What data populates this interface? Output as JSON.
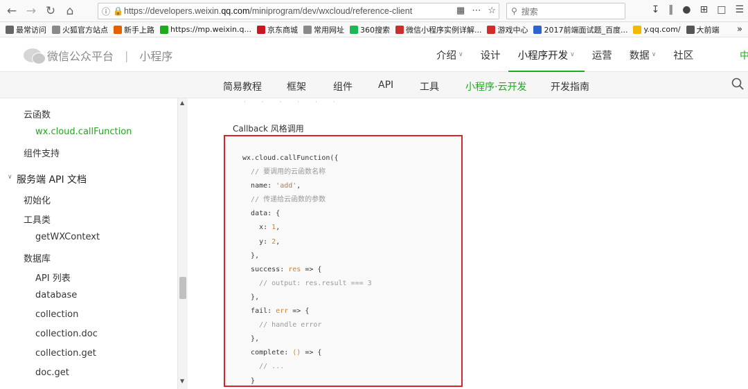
{
  "browser": {
    "url_prefix": "https://developers.weixin.",
    "url_domain": "qq.com",
    "url_path": "/miniprogram/dev/wxcloud/reference-client",
    "search_placeholder": "搜索",
    "bookmarks": [
      {
        "label": "最常访问",
        "icon": "gear-icon",
        "color": "#666666"
      },
      {
        "label": "火狐官方站点",
        "icon": "folder-icon",
        "color": "#8a8a8a"
      },
      {
        "label": "新手上路",
        "icon": "firefox-icon",
        "color": "#e66000"
      },
      {
        "label": "https://mp.weixin.q...",
        "icon": "wechat-icon",
        "color": "#1aad19"
      },
      {
        "label": "京东商城",
        "icon": "jd-icon",
        "color": "#c91623"
      },
      {
        "label": "常用网址",
        "icon": "folder-icon",
        "color": "#8a8a8a"
      },
      {
        "label": "360搜索",
        "icon": "360-icon",
        "color": "#19b955"
      },
      {
        "label": "微信小程序实例详解...",
        "icon": "csdn-icon",
        "color": "#c9302c"
      },
      {
        "label": "游戏中心",
        "icon": "game-icon",
        "color": "#d12b2b"
      },
      {
        "label": "2017前端面试题_百度...",
        "icon": "baidu-icon",
        "color": "#2d64cf"
      },
      {
        "label": "y.qq.com/",
        "icon": "qqmusic-icon",
        "color": "#f5b800"
      },
      {
        "label": "大前端",
        "icon": "globe-icon",
        "color": "#555555"
      }
    ]
  },
  "site": {
    "logo_text": "微信公众平台",
    "divider": "|",
    "section": "小程序",
    "nav": [
      {
        "label": "介绍",
        "dropdown": true
      },
      {
        "label": "设计",
        "dropdown": false
      },
      {
        "label": "小程序开发",
        "dropdown": true,
        "active": true
      },
      {
        "label": "运营",
        "dropdown": false
      },
      {
        "label": "数据",
        "dropdown": true
      },
      {
        "label": "社区",
        "dropdown": false
      }
    ],
    "nav_cut": "中",
    "subnav": [
      "简易教程",
      "框架",
      "组件",
      "API",
      "工具",
      "小程序·云开发",
      "开发指南"
    ],
    "subnav_active": "小程序·云开发"
  },
  "sidebar": {
    "items": [
      {
        "label": "云函数"
      },
      {
        "label": "wx.cloud.callFunction",
        "active": true
      },
      {
        "label": "组件支持"
      },
      {
        "label": "服务端 API 文档",
        "group": true
      },
      {
        "label": "初始化"
      },
      {
        "label": "工具类"
      },
      {
        "label": "getWXContext"
      },
      {
        "label": "数据库"
      },
      {
        "label": "API 列表"
      },
      {
        "label": "database"
      },
      {
        "label": "collection"
      },
      {
        "label": "collection.doc"
      },
      {
        "label": "collection.get"
      },
      {
        "label": "doc.get"
      }
    ]
  },
  "content": {
    "heading": "Callback 风格调用",
    "code": {
      "l1": "wx.cloud.callFunction({",
      "l2": "// 要调用的云函数名称",
      "l3a": "name: ",
      "l3b": "'add'",
      "l3c": ",",
      "l4": "// 传递给云函数的参数",
      "l5": "data: {",
      "l6a": "x: ",
      "l6b": "1",
      "l6c": ",",
      "l7a": "y: ",
      "l7b": "2",
      "l7c": ",",
      "l8": "},",
      "l9a": "success: ",
      "l9b": "res",
      "l9c": " => {",
      "l10": "// output: res.result === 3",
      "l11": "},",
      "l12a": "fail: ",
      "l12b": "err",
      "l12c": " => {",
      "l13": "// handle error",
      "l14": "},",
      "l15a": "complete: ",
      "l15b": "()",
      "l15c": " => {",
      "l16": "// ...",
      "l17": "}"
    }
  }
}
